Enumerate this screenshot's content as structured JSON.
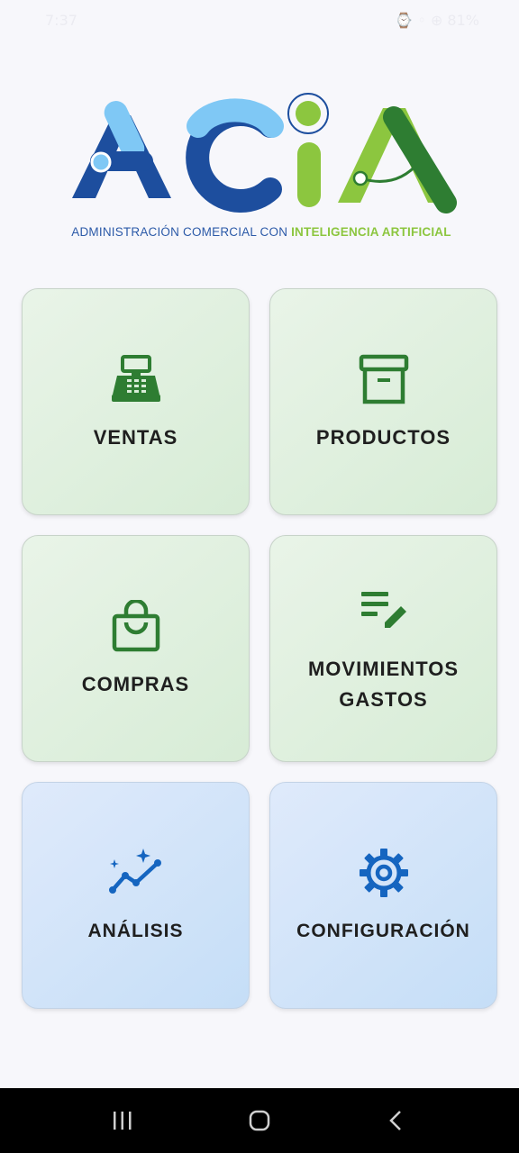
{
  "status_bar": {
    "time": "7:37",
    "right": "⌚ ◦ ⊕ 81%"
  },
  "logo": {
    "letters": "ACIA",
    "tagline_part1": "ADMINISTRACIÓN COMERCIAL CON ",
    "tagline_part2": "INTELIGENCIA ARTIFICIAL"
  },
  "menu": {
    "ventas": "VENTAS",
    "productos": "PRODUCTOS",
    "compras": "COMPRAS",
    "movimientos_line1": "MOVIMIENTOS",
    "movimientos_line2": "GASTOS",
    "analisis": "ANÁLISIS",
    "configuracion": "CONFIGURACIÓN"
  },
  "icons": {
    "ventas": "cash-register-icon",
    "productos": "archive-box-icon",
    "compras": "shopping-bag-icon",
    "movimientos": "edit-list-icon",
    "analisis": "trend-sparkle-icon",
    "configuracion": "gear-icon"
  },
  "colors": {
    "green_icon": "#2e7d32",
    "blue_icon": "#1565c0",
    "logo_dark_blue": "#1d4e9e",
    "logo_light_blue": "#7fc8f5",
    "logo_green": "#8cc63f",
    "logo_dark_green": "#2e7d32"
  }
}
